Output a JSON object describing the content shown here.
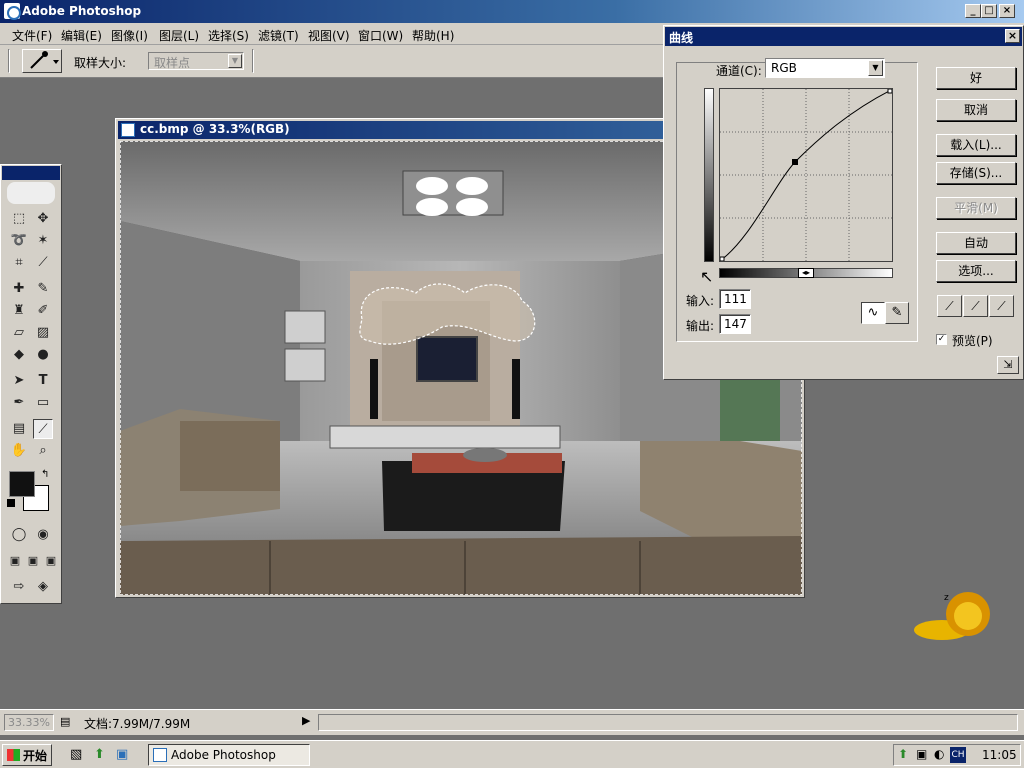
{
  "window": {
    "title": "Adobe Photoshop"
  },
  "menu": [
    "文件(F)",
    "编辑(E)",
    "图像(I)",
    "图层(L)",
    "选择(S)",
    "滤镜(T)",
    "视图(V)",
    "窗口(W)",
    "帮助(H)"
  ],
  "options": {
    "sample_size_label": "取样大小:",
    "sample_size_value": "取样点"
  },
  "document": {
    "title": "cc.bmp @ 33.3%(RGB)"
  },
  "curves": {
    "title": "曲线",
    "channel_label": "通道(C):",
    "channel_value": "RGB",
    "input_label": "输入:",
    "input_value": "111",
    "output_label": "输出:",
    "output_value": "147",
    "buttons": {
      "ok": "好",
      "cancel": "取消",
      "load": "载入(L)...",
      "save": "存储(S)...",
      "smooth": "平滑(M)",
      "auto": "自动",
      "options": "选项..."
    },
    "preview_label": "预览(P)",
    "preview_checked": true
  },
  "status": {
    "zoom": "33.33%",
    "doc_info": "文档:7.99M/7.99M"
  },
  "taskbar": {
    "start": "开始",
    "task": "Adobe Photoshop",
    "lang": "CH",
    "clock": "11:05"
  },
  "colors": {
    "title_blue": "#0a246a",
    "face": "#d4d0c8",
    "workspace": "#6f6f6f"
  }
}
